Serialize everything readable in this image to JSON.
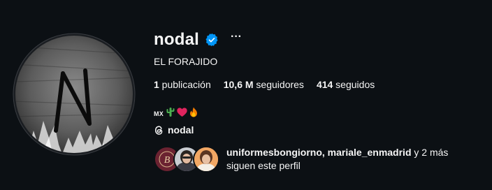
{
  "profile": {
    "username": "nodal",
    "full_name": "EL FORAJIDO",
    "avatar_letter": "N",
    "verified_icon": "verified-badge-icon",
    "more_label": "···"
  },
  "stats": {
    "posts_count": "1",
    "posts_label": " publicación",
    "followers_count": "10,6 M",
    "followers_label": " seguidores",
    "following_count": "414",
    "following_label": " seguidos"
  },
  "bio": {
    "country": "MX",
    "emojis": [
      "cactus-icon",
      "heart-icon",
      "fire-icon"
    ]
  },
  "threads": {
    "icon": "threads-icon",
    "label": "nodal"
  },
  "followed_by": {
    "names": "uniformesbongiorno, mariale_enmadrid",
    "suffix_1": " y ",
    "more": "2 más",
    "suffix_2": " siguen este perfil"
  },
  "colors": {
    "background": "#0c1014",
    "text": "#f5f5f5",
    "verified_blue": "#0095f6",
    "heart_red": "#e0245e"
  }
}
